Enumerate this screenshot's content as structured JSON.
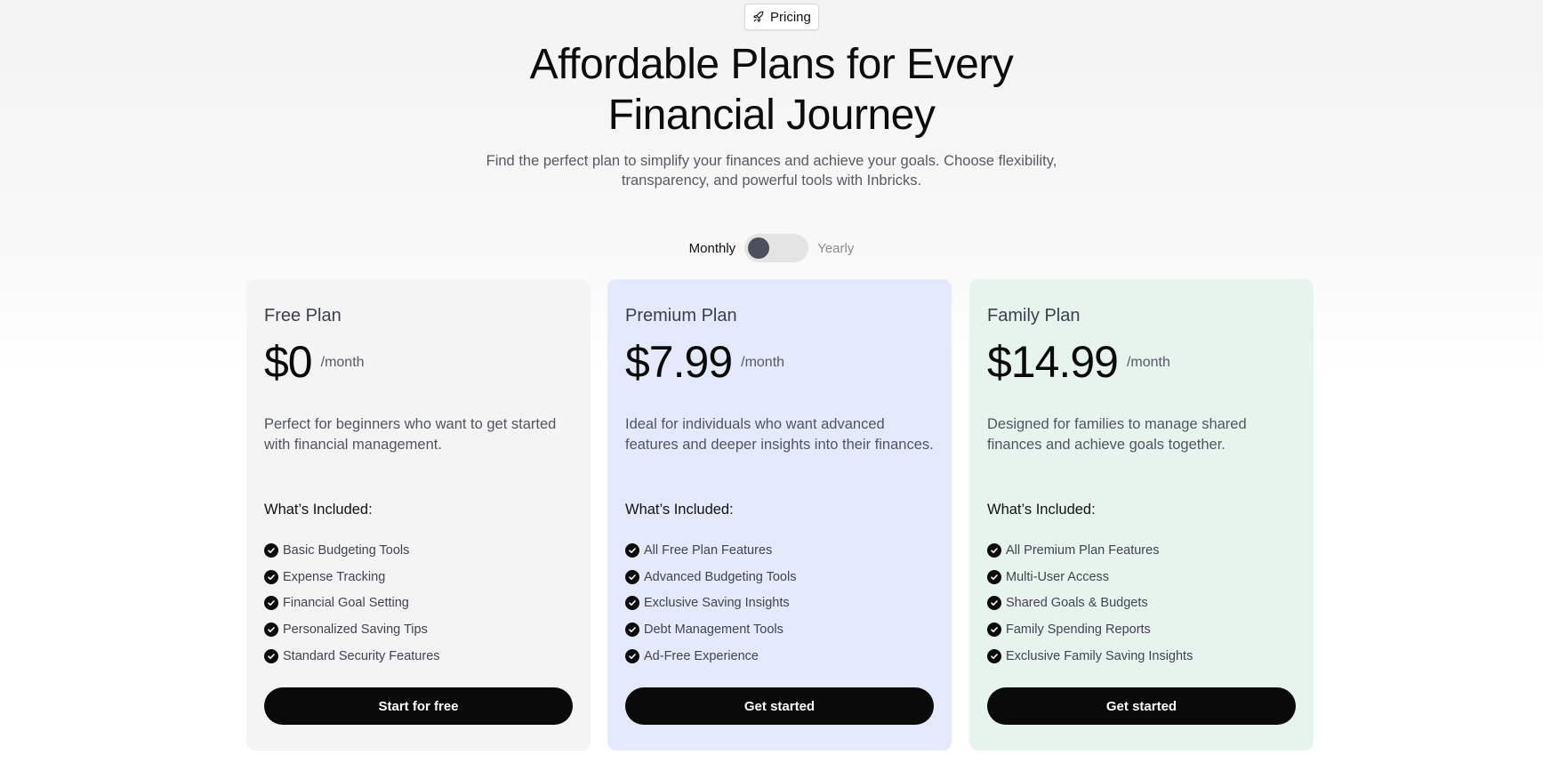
{
  "badge": {
    "icon": "rocket-icon",
    "label": "Pricing"
  },
  "hero": {
    "title_line1": "Affordable Plans for Every",
    "title_line2": "Financial Journey",
    "subtitle_line1": "Find the perfect plan to simplify your finances and achieve your goals. Choose flexibility,",
    "subtitle_line2": "transparency, and powerful tools with Inbricks."
  },
  "billing_toggle": {
    "left_label": "Monthly",
    "right_label": "Yearly",
    "selected": "Monthly"
  },
  "plans": [
    {
      "name": "Free Plan",
      "price": "$0",
      "period": "/month",
      "description": "Perfect for beginners who want to get started with financial management.",
      "included_heading": "What’s Included:",
      "features": [
        "Basic Budgeting Tools",
        "Expense Tracking",
        "Financial Goal Setting",
        "Personalized Saving Tips",
        "Standard Security Features"
      ],
      "cta": "Start for free",
      "bg_color": "#f4f4f4"
    },
    {
      "name": "Premium Plan",
      "price": "$7.99",
      "period": "/month",
      "description": "Ideal for individuals who want advanced features and deeper insights into their finances.",
      "included_heading": "What’s Included:",
      "features": [
        "All Free Plan Features",
        "Advanced Budgeting Tools",
        "Exclusive Saving Insights",
        "Debt Management Tools",
        "Ad-Free Experience"
      ],
      "cta": "Get started",
      "bg_color": "#e4eafc"
    },
    {
      "name": "Family Plan",
      "price": "$14.99",
      "period": "/month",
      "description": "Designed for families to manage shared finances and achieve goals together.",
      "included_heading": "What’s Included:",
      "features": [
        "All Premium Plan Features",
        "Multi-User Access",
        "Shared Goals & Budgets",
        "Family Spending Reports",
        "Exclusive Family Saving Insights"
      ],
      "cta": "Get started",
      "bg_color": "#e7f4ee"
    }
  ],
  "colors": {
    "button_bg": "#0a0a0a",
    "toggle_knob": "#4b505c",
    "toggle_track": "#e4e4e4"
  }
}
